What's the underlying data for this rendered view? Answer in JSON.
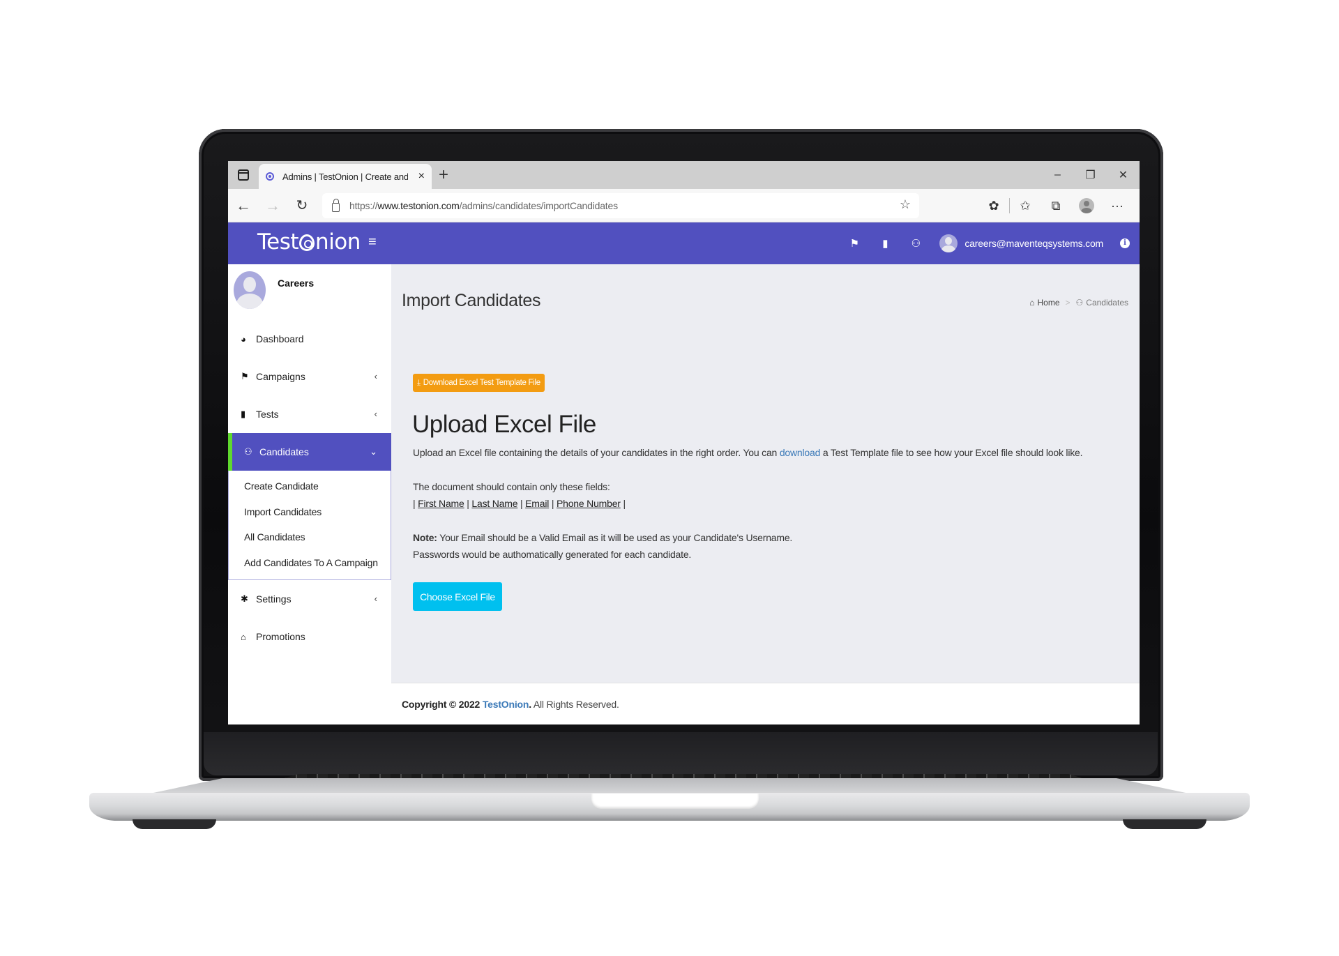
{
  "browser": {
    "tab_title": "Admins | TestOnion | Create and",
    "tab_close": "×",
    "new_tab": "+",
    "window_controls": {
      "minimize": "–",
      "restore": "❐",
      "close": "✕"
    },
    "nav": {
      "back": "←",
      "forward": "→",
      "reload": "↻"
    },
    "url_prefix": "https://",
    "url_host": "www.testonion.com",
    "url_path": "/admins/candidates/importCandidates",
    "toolbar_icons": [
      "add-favorite-icon",
      "extensions-icon",
      "favorites-icon",
      "collections-icon",
      "profile-icon",
      "more-icon"
    ],
    "icon_glyphs": {
      "favorite_add": "☆",
      "extensions": "✿",
      "favorites": "✩",
      "collections": "⧉",
      "more": "···"
    }
  },
  "app": {
    "logo_prefix": "Test",
    "logo_suffix": "nion",
    "hamburger": "≡",
    "header_icons": {
      "campaigns": "📢",
      "tests": "📘",
      "candidates": "👥"
    },
    "header_icon_glyphs": [
      "⚑",
      "▮",
      "⚇"
    ],
    "user_email": "careers@maventeqsystems.com",
    "info": "i",
    "brand_color": "#5150bf"
  },
  "sidebar": {
    "user_name": "Careers",
    "items": [
      {
        "label": "Dashboard",
        "icon": "dashboard-icon",
        "glyph": "◕",
        "has_caret": false
      },
      {
        "label": "Campaigns",
        "icon": "bullhorn-icon",
        "glyph": "⚑",
        "has_caret": true,
        "caret": "‹"
      },
      {
        "label": "Tests",
        "icon": "book-icon",
        "glyph": "▮",
        "has_caret": true,
        "caret": "‹"
      },
      {
        "label": "Candidates",
        "icon": "users-icon",
        "glyph": "⚇",
        "active": true,
        "caret": "⌄"
      },
      {
        "label": "Settings",
        "icon": "gear-icon",
        "glyph": "✱",
        "has_caret": true,
        "caret": "‹"
      },
      {
        "label": "Promotions",
        "icon": "gift-icon",
        "glyph": "⌂",
        "has_caret": false
      }
    ],
    "submenu": [
      "Create Candidate",
      "Import Candidates",
      "All Candidates",
      "Add Candidates To A Campaign"
    ],
    "active_accent": "#5fd82e"
  },
  "main": {
    "page_title": "Import Candidates",
    "breadcrumb": {
      "home_icon": "⌂",
      "home": "Home",
      "separator": ">",
      "current_icon": "⚇",
      "current": "Candidates"
    },
    "download_button": {
      "icon": "⤓",
      "label": "Download Excel Test Template File"
    },
    "upload_title": "Upload Excel File",
    "intro_before": "Upload an Excel file containing the details of your candidates in the right order. You can ",
    "intro_link": "download",
    "intro_after": " a Test Template file to see how your Excel file should look like.",
    "fields_heading": "The document should contain only these fields:",
    "fields": [
      "First Name",
      "Last Name",
      "Email",
      "Phone Number"
    ],
    "note_label": "Note:",
    "note_text": " Your Email should be a Valid Email as it will be used as your Candidate's Username.",
    "note_text_2": "Passwords would be authomatically generated for each candidate.",
    "choose_button": "Choose Excel File"
  },
  "footer": {
    "copyright": "Copyright © 2022",
    "brand": "TestOnion",
    "period": ".",
    "rights": " All Rights Reserved."
  }
}
